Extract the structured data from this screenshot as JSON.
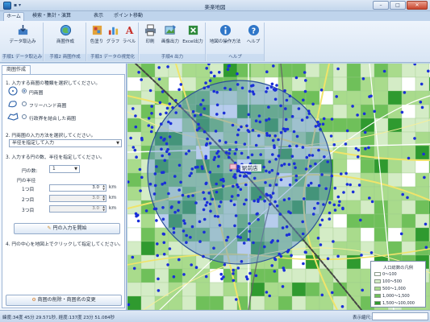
{
  "window": {
    "title": "楽楽地図",
    "qat": "▪ ▾",
    "controls": [
      "–",
      "□",
      "✕"
    ]
  },
  "ribbon": {
    "tabs": [
      "ホーム",
      "検索・集計・演算",
      "表示",
      "ポイント移動"
    ],
    "active_tab": "ホーム",
    "groups": [
      {
        "label": "手順1 データ取込み",
        "buttons": [
          "データ取込み"
        ]
      },
      {
        "label": "手順2 商圏作成",
        "buttons": [
          "商圏作成"
        ]
      },
      {
        "label": "手順3 データの視覚化",
        "buttons": [
          "色塗り",
          "グラフ",
          "ラベル"
        ]
      },
      {
        "label": "手順4 出力",
        "buttons": [
          "印刷",
          "画像出力",
          "Excel出力"
        ]
      },
      {
        "label": "ヘルプ",
        "buttons": [
          "地図の操作方法",
          "ヘルプ"
        ]
      }
    ]
  },
  "panel": {
    "tab": "商圏作成",
    "step1": "1. 入力する商圏の種類を選択してください。",
    "options": [
      "円商圏",
      "フリーハンド商圏",
      "行政界を結合した商圏"
    ],
    "step2": "2. 円商圏の入力方法を選択してください。",
    "method_value": "半径を指定して入力",
    "step3": "3. 入力する円の数、半径を指定してください。",
    "circle_count_label": "円の数:",
    "circle_count_value": "1",
    "radius_header": "円の半径",
    "radii": [
      {
        "label": "1つ目",
        "value": "3.0",
        "unit": "km"
      },
      {
        "label": "2つ目",
        "value": "3.0",
        "unit": "km"
      },
      {
        "label": "3つ目",
        "value": "3.0",
        "unit": "km"
      }
    ],
    "start_button": "円の入力を開始",
    "step4": "4. 円の中心を地図上でクリックして指定してください。",
    "bottom_button": "商圏の削除・商圏名の変更"
  },
  "map": {
    "station_label": "駅前店",
    "legend": {
      "title": "人口総数の凡例",
      "items": [
        {
          "label": "0～100",
          "color": "#ffffff"
        },
        {
          "label": "100～500",
          "color": "#d4ecc6"
        },
        {
          "label": "500～1,000",
          "color": "#a9db8c"
        },
        {
          "label": "1,000～1,500",
          "color": "#6fc05a"
        },
        {
          "label": "1,500～100,000",
          "color": "#2f9a2f"
        }
      ]
    },
    "colors": {
      "circle_fill": "#5f8fd6",
      "point": "#1a2fd8",
      "road": "#f0e46a"
    }
  },
  "status": {
    "coords": "緯度:34度 45分 29.571秒, 経度:137度 23分 51.084秒",
    "scale_label": "表示縮尺:"
  }
}
